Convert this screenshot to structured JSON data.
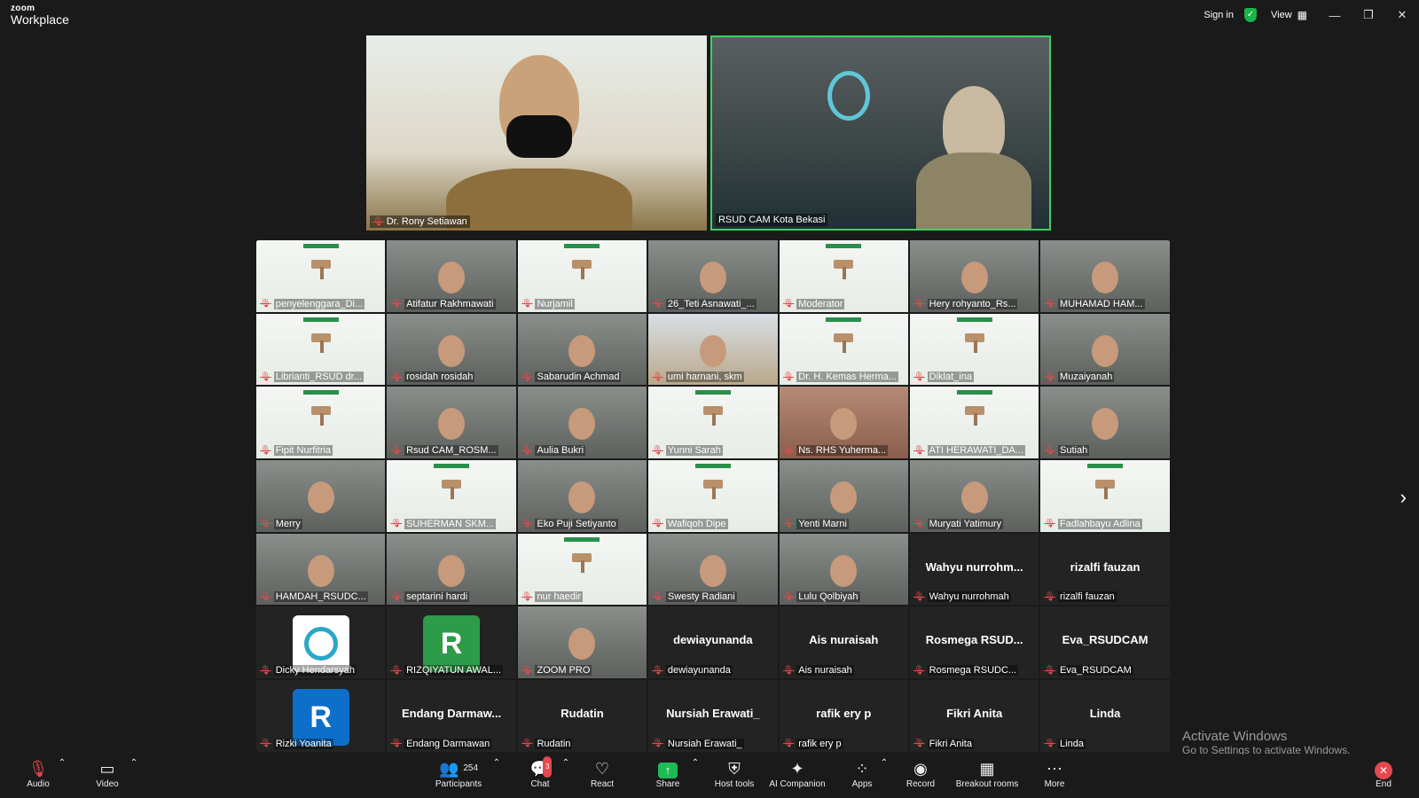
{
  "app": {
    "logo_line1": "zoom",
    "logo_line2": "Workplace"
  },
  "titlebar": {
    "sign_in": "Sign in",
    "view": "View"
  },
  "stage": [
    {
      "name": "Dr. Rony Setiawan"
    },
    {
      "name": "RSUD CAM Kota Bekasi"
    }
  ],
  "participants": [
    {
      "name": "penyelenggara_Di...",
      "kind": "webinar"
    },
    {
      "name": "Atifatur Rakhmawati",
      "kind": "video"
    },
    {
      "name": "Nurjamil",
      "kind": "webinar"
    },
    {
      "name": "26_Teti Asnawati_...",
      "kind": "video"
    },
    {
      "name": "Moderator",
      "kind": "webinar"
    },
    {
      "name": "Hery rohyanto_Rs...",
      "kind": "video"
    },
    {
      "name": "MUHAMAD HAM...",
      "kind": "video"
    },
    {
      "name": "Librianti_RSUD dr...",
      "kind": "webinar"
    },
    {
      "name": "rosidah rosidah",
      "kind": "video"
    },
    {
      "name": "Sabarudin Achmad",
      "kind": "video"
    },
    {
      "name": "umi harnani, skm",
      "kind": "bldg"
    },
    {
      "name": "Dr. H. Kemas Herma...",
      "kind": "webinar"
    },
    {
      "name": "Diklat_ina",
      "kind": "webinar"
    },
    {
      "name": "Muzaiyanah",
      "kind": "video"
    },
    {
      "name": "Fipit Nurfitria",
      "kind": "webinar"
    },
    {
      "name": "Rsud CAM_ROSM...",
      "kind": "video"
    },
    {
      "name": "Aulia Bukri",
      "kind": "video"
    },
    {
      "name": "Yunni Sarah",
      "kind": "webinar"
    },
    {
      "name": "Ns. RHS Yuherma...",
      "kind": "beige"
    },
    {
      "name": "ATI HERAWATI_DA...",
      "kind": "webinar"
    },
    {
      "name": "Sutiah",
      "kind": "video"
    },
    {
      "name": "Merry",
      "kind": "video"
    },
    {
      "name": "SUHERMAN SKM...",
      "kind": "webinar"
    },
    {
      "name": "Eko Puji Setiyanto",
      "kind": "video"
    },
    {
      "name": "Wafiqoh Dipe",
      "kind": "webinar"
    },
    {
      "name": "Yenti Marni",
      "kind": "video"
    },
    {
      "name": "Muryati Yatimury",
      "kind": "video"
    },
    {
      "name": "Fadlahbayu Adlina",
      "kind": "webinar"
    },
    {
      "name": "HAMDAH_RSUDC...",
      "kind": "video"
    },
    {
      "name": "septarini hardi",
      "kind": "video"
    },
    {
      "name": "nur haedir",
      "kind": "webinar"
    },
    {
      "name": "Swesty Radiani",
      "kind": "video"
    },
    {
      "name": "Lulu Qolbiyah",
      "kind": "video"
    },
    {
      "name": "Wahyu nurrohmah",
      "kind": "text",
      "big": "Wahyu  nurrohm..."
    },
    {
      "name": "rizalfi fauzan",
      "kind": "text",
      "big": "rizalfi fauzan"
    },
    {
      "name": "Dicky Hendarsyah",
      "kind": "logo"
    },
    {
      "name": "RIZQIYATUN AWAL...",
      "kind": "avatar",
      "letter": "R",
      "color": "#2e9b49"
    },
    {
      "name": "ZOOM PRO",
      "kind": "video"
    },
    {
      "name": "dewiayunanda",
      "kind": "text",
      "big": "dewiayunanda"
    },
    {
      "name": "Ais nuraisah",
      "kind": "text",
      "big": "Ais nuraisah"
    },
    {
      "name": "Rosmega RSUDC...",
      "kind": "text",
      "big": "Rosmega  RSUD..."
    },
    {
      "name": "Eva_RSUDCAM",
      "kind": "text",
      "big": "Eva_RSUDCAM"
    },
    {
      "name": "Rizki Yoanita",
      "kind": "avatar",
      "letter": "R",
      "color": "#0d6fc8"
    },
    {
      "name": "Endang Darmawan",
      "kind": "text",
      "big": "Endang  Darmaw..."
    },
    {
      "name": "Rudatin",
      "kind": "text",
      "big": "Rudatin"
    },
    {
      "name": "Nursiah Erawati_",
      "kind": "text",
      "big": "Nursiah Erawati_"
    },
    {
      "name": "rafik ery p",
      "kind": "text",
      "big": "rafik ery p"
    },
    {
      "name": "Fikri Anita",
      "kind": "text",
      "big": "Fikri Anita"
    },
    {
      "name": "Linda",
      "kind": "text",
      "big": "Linda"
    }
  ],
  "watermark": {
    "line1": "Activate Windows",
    "line2": "Go to Settings to activate Windows."
  },
  "toolbar": {
    "audio": "Audio",
    "video": "Video",
    "participants": "Participants",
    "participants_count": "254",
    "chat": "Chat",
    "chat_badge": "3",
    "react": "React",
    "share": "Share",
    "host_tools": "Host tools",
    "ai_companion": "AI Companion",
    "apps": "Apps",
    "record": "Record",
    "breakout_rooms": "Breakout rooms",
    "more": "More",
    "end": "End"
  },
  "colors": {
    "mic_muted": "#e5484d",
    "share": "#1fba55",
    "active_speaker": "#3cd164"
  }
}
